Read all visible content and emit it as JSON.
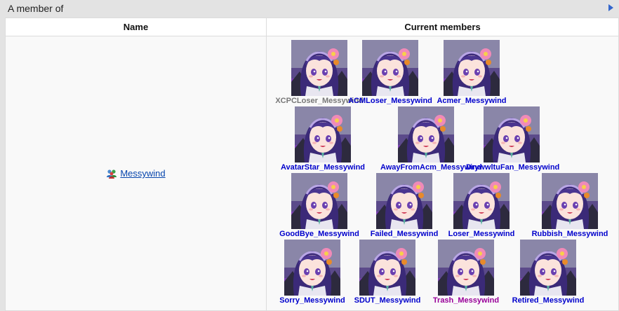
{
  "panel": {
    "title": "A member of"
  },
  "table": {
    "col_name": "Name",
    "col_members": "Current members"
  },
  "group": {
    "name": "Messywind"
  },
  "colors": {
    "gray": "#777777",
    "blue": "#0000cc",
    "purple": "#990099",
    "link": "#0645ad"
  },
  "members": [
    {
      "name": "XCPCLoser_Messywind",
      "color": "gray"
    },
    {
      "name": "ACMLoser_Messywind",
      "color": "blue"
    },
    {
      "name": "Acmer_Messywind",
      "color": "blue"
    },
    {
      "name": "AvatarStar_Messywind",
      "color": "blue"
    },
    {
      "name": "AwayFromAcm_Messywind",
      "color": "blue"
    },
    {
      "name": "DrywwltuFan_Messywind",
      "color": "blue"
    },
    {
      "name": "GoodBye_Messywind",
      "color": "blue"
    },
    {
      "name": "Failed_Messywind",
      "color": "blue"
    },
    {
      "name": "Loser_Messywind",
      "color": "blue"
    },
    {
      "name": "Rubbish_Messywind",
      "color": "blue"
    },
    {
      "name": "Sorry_Messywind",
      "color": "blue"
    },
    {
      "name": "SDUT_Messywind",
      "color": "blue"
    },
    {
      "name": "Trash_Messywind",
      "color": "purple"
    },
    {
      "name": "Retired_Messywind",
      "color": "blue"
    }
  ]
}
